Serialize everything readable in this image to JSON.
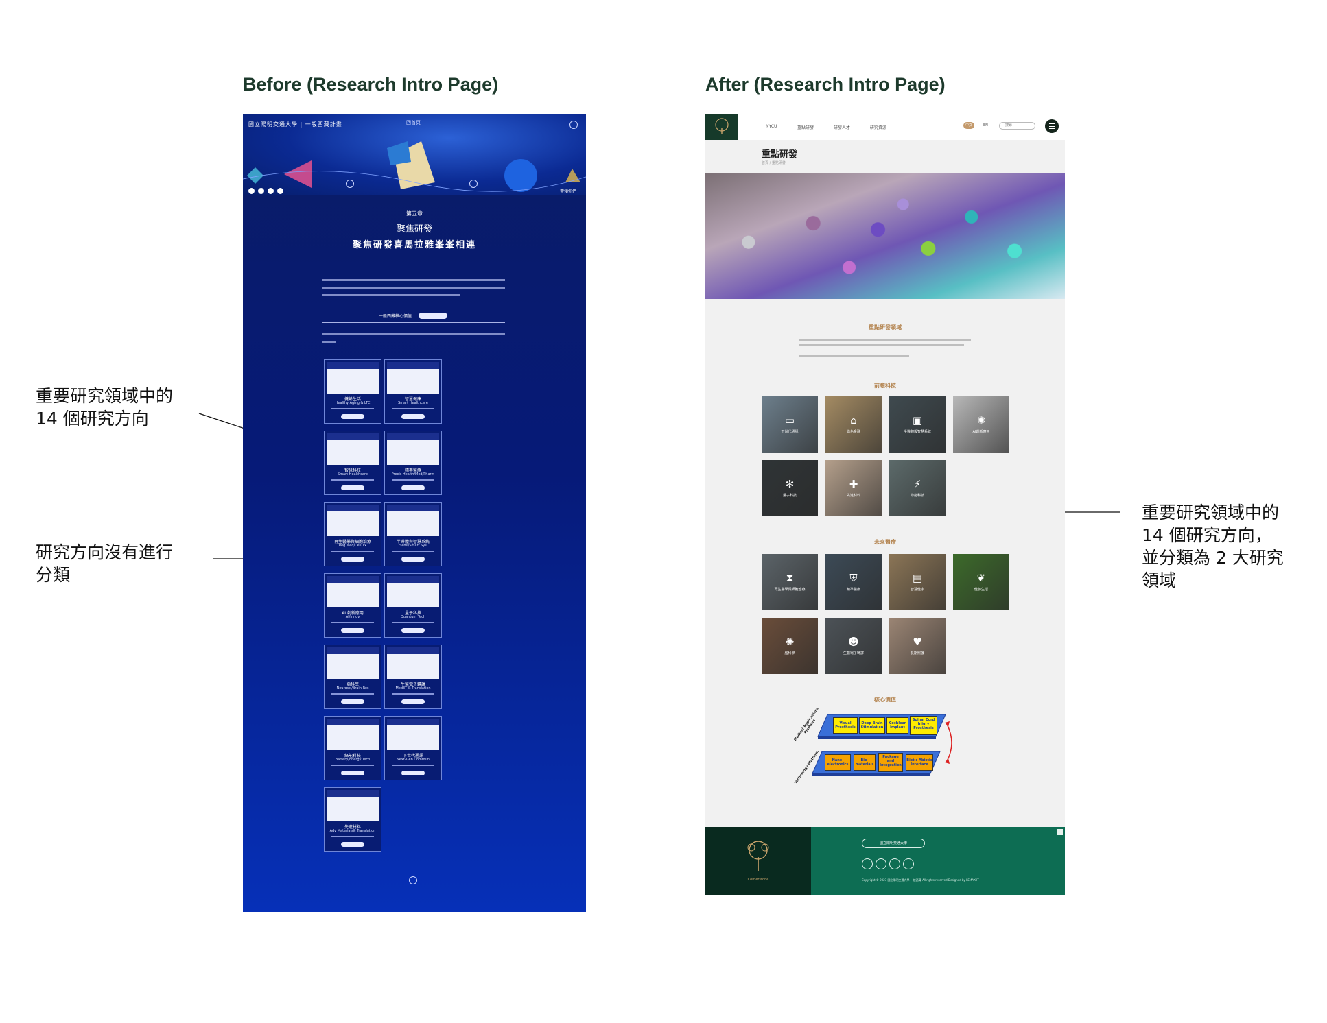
{
  "before_heading": "Before (Research Intro Page)",
  "after_heading": "After (Research Intro Page)",
  "notes": {
    "left_1": [
      "重要研究領域中的",
      "14 個研究方向"
    ],
    "left_2": [
      "研究方向沒有進行",
      "分類"
    ],
    "right": [
      "重要研究領域中的",
      "14 個研究方向，",
      "並分類為 2 大研究",
      "領域"
    ]
  },
  "before": {
    "logo": "國立陽明交通大學 | 一般西藏計畫",
    "home": "回首頁",
    "banner_badge": "帶領你們",
    "chapter": "第五章",
    "title_1": "聚焦研發",
    "title_2": "聚焦研發喜馬拉雅峯峯相連",
    "action_label": "一般西藏核心價值",
    "cards": [
      {
        "zh": "健齡生活",
        "en": "Healthy Aging & LTC"
      },
      {
        "zh": "智慧健康",
        "en": "Smart Healthcare"
      },
      {
        "zh": "智慧科技",
        "en": "Smart Healthcare"
      },
      {
        "zh": "精準醫療",
        "en": "Precis Health/Med/Pharm"
      },
      {
        "zh": "再生醫學與細胞治療",
        "en": "Reg Med/Cell Tx"
      },
      {
        "zh": "半導體與智慧系統",
        "en": "Semi/Smart Sys"
      },
      {
        "zh": "AI 創新應用",
        "en": "AI/Innov"
      },
      {
        "zh": "量子科技",
        "en": "Quantum Tech"
      },
      {
        "zh": "腦科學",
        "en": "Neurosci/Brain Res"
      },
      {
        "zh": "生醫電子轉譯",
        "en": "MedET & Translation"
      },
      {
        "zh": "綠能科技",
        "en": "Battery/Energy Tech"
      },
      {
        "zh": "下世代通訊",
        "en": "Next-Gen Commun"
      },
      {
        "zh": "先進材料",
        "en": "Adv Materials& Translation"
      }
    ]
  },
  "after": {
    "nav": [
      "NYCU",
      "重點研發",
      "研發人才",
      "研究資源"
    ],
    "lang": "中文",
    "lang_alt": "EN",
    "search_placeholder": "搜尋",
    "page_title": "重點研發",
    "breadcrumb": "首頁 / 重點研發",
    "section_main": "重點研發領域",
    "section_1": "前瞻科技",
    "section_2": "未來醫療",
    "section_3": "核心價值",
    "tiles_1": [
      {
        "label": "下世代通訊",
        "icon": "chat-icon",
        "color": "#6d7f8c"
      },
      {
        "label": "綠色金融",
        "icon": "bank-icon",
        "color": "#a48b63"
      },
      {
        "label": "半導體與智慧系統",
        "icon": "chip-icon",
        "color": "#3f4a4f"
      },
      {
        "label": "AI創新應用",
        "icon": "brain-icon",
        "color": "#b8b8b8"
      },
      {
        "label": "量子科技",
        "icon": "atom-icon",
        "color": "#2f3436"
      },
      {
        "label": "先進材料",
        "icon": "medkit-icon",
        "color": "#b49f8b"
      },
      {
        "label": "綠能科技",
        "icon": "battery-icon",
        "color": "#5c6a6a"
      }
    ],
    "tiles_2": [
      {
        "label": "再生醫學與細胞治療",
        "icon": "hourglass-icon",
        "color": "#5b6368"
      },
      {
        "label": "精準醫療",
        "icon": "shield-icon",
        "color": "#3c4a56"
      },
      {
        "label": "智慧健康",
        "icon": "notebook-icon",
        "color": "#8b7556"
      },
      {
        "label": "健齡生活",
        "icon": "leaf-icon",
        "color": "#3c6a2a"
      },
      {
        "label": "腦科學",
        "icon": "brain-icon",
        "color": "#6a4d3a"
      },
      {
        "label": "生醫電子轉譯",
        "icon": "head-icon",
        "color": "#4c5257"
      },
      {
        "label": "長期照護",
        "icon": "care-icon",
        "color": "#9b8574"
      }
    ],
    "platform": {
      "top_label": "Medical Applications Platform",
      "bottom_label": "Technology Platform",
      "top": [
        "Visual Prosthesis",
        "Deep Brain Stimulation",
        "Cochlear Implant",
        "Spinal Cord Injury Prosthesis"
      ],
      "bottom": [
        "Nano-electronics",
        "Bio-materials",
        "Package and Integration",
        "Biotic Abiotic Interface"
      ]
    },
    "footer_button": "國立陽明交通大學",
    "footer_logo": "Cornerstone",
    "copyright": "Copyright © 2023 國立陽明交通大學 一般西藏 All rights reserved Designed by LEMAX.IT"
  }
}
